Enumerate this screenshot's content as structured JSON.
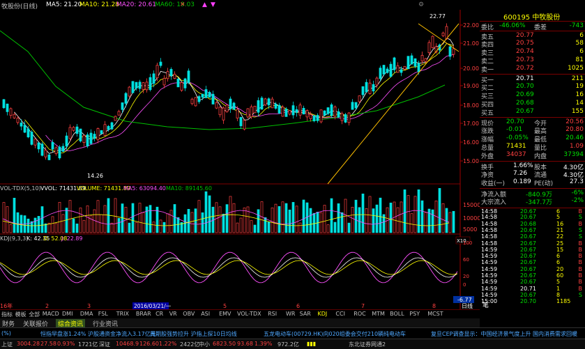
{
  "colors": {
    "up": "#ff4040",
    "down": "#00e0e0",
    "ma5": "#ffffff",
    "ma10": "#ffff00",
    "ma20": "#ff50ff",
    "ma60": "#00c000",
    "axis": "#a00000",
    "price_label": "#ff4040"
  },
  "header": {
    "title": "牧股份(日线)",
    "ma5": "MA5: 21.20",
    "ma10": "MA10: 21.28",
    "ma20": "MA20: 20.61",
    "ma60": "MA60: 19.03",
    "icons": [
      "close-icon",
      "arrow-up-icon",
      "arrow-down-icon",
      "settings-icon"
    ]
  },
  "price_axis": [
    "22.00",
    "21.00",
    "20.00",
    "19.00",
    "18.00",
    "17.00",
    "16.00",
    "15.00"
  ],
  "price_marks": {
    "high": "22.77",
    "low": "14.26"
  },
  "volume_header": {
    "name": "VOL-TDX(5,10)",
    "vvol": "VVOL: 71431.89",
    "volume": "VOLUME: 71431.89",
    "ma5": "MA5: 63094.40",
    "ma10": "MA10: 89145.60"
  },
  "volume_axis": [
    "15000",
    "10000",
    "5000"
  ],
  "volume_unit": "X10",
  "kdj_header": {
    "name": "KDJ(9,3,3)",
    "k": "K: 42.35",
    "d": "D: 52.08",
    "j": "J: 22.89"
  },
  "kdj_axis": [
    "100",
    "80",
    "60",
    "40",
    "20",
    "0"
  ],
  "kdj_last": "-6.77",
  "date_labels": {
    "start": "16年",
    "m2": "2",
    "m3": "3",
    "cursor": "2016/03/21/一",
    "m4": "4",
    "m5": "5",
    "m6": "6",
    "m7": "7",
    "m8": "8",
    "period": "日线"
  },
  "indicator_tabs": [
    "指标",
    "模板",
    "全部",
    "MACD",
    "DMI",
    "DMA",
    "FSL",
    "TRIX",
    "BRAR",
    "CR",
    "VR",
    "OBV",
    "ASI",
    "EMV",
    "VOL-TDX",
    "RSI",
    "WR",
    "SAR",
    "KDJ",
    "CCI",
    "ROC",
    "MTM",
    "BOLL",
    "PSY",
    "MCST"
  ],
  "active_indicator": "KDJ",
  "bottom_tabs": [
    "财务",
    "关联报价",
    "综合资讯",
    "行业资讯"
  ],
  "active_bottom_tab": "综合资讯",
  "quote": {
    "code_name": "600195 中牧股份",
    "ratio_label": "委比",
    "ratio": "-46.06%",
    "diff_label": "委差",
    "diff": "-743",
    "sells": [
      {
        "label": "卖五",
        "price": "20.77",
        "vol": "6"
      },
      {
        "label": "卖四",
        "price": "20.75",
        "vol": "58"
      },
      {
        "label": "卖三",
        "price": "20.74",
        "vol": "6"
      },
      {
        "label": "卖二",
        "price": "20.73",
        "vol": "81"
      },
      {
        "label": "卖一",
        "price": "20.72",
        "vol": "1025"
      }
    ],
    "buys": [
      {
        "label": "买一",
        "price": "20.71",
        "vol": "211"
      },
      {
        "label": "买二",
        "price": "20.70",
        "vol": "19"
      },
      {
        "label": "买三",
        "price": "20.69",
        "vol": "16"
      },
      {
        "label": "买四",
        "price": "20.68",
        "vol": "14"
      },
      {
        "label": "买五",
        "price": "20.67",
        "vol": "155"
      }
    ],
    "stats": [
      {
        "l1": "现价",
        "v1": "20.70",
        "l2": "今开",
        "v2": "20.56",
        "c1": "grn",
        "c2": "red"
      },
      {
        "l1": "涨跌",
        "v1": "-0.01",
        "l2": "最高",
        "v2": "20.80",
        "c1": "grn",
        "c2": "red"
      },
      {
        "l1": "涨幅",
        "v1": "-0.05%",
        "l2": "最低",
        "v2": "20.46",
        "c1": "grn",
        "c2": "grn"
      },
      {
        "l1": "总量",
        "v1": "71431",
        "l2": "量比",
        "v2": "1.09",
        "c1": "yel",
        "c2": "red"
      },
      {
        "l1": "外盘",
        "v1": "34037",
        "l2": "内盘",
        "v2": "37394",
        "c1": "red",
        "c2": "grn"
      }
    ],
    "stats2": [
      {
        "l1": "换手",
        "v1": "1.66%",
        "l2": "股本",
        "v2": "4.30亿"
      },
      {
        "l1": "净资",
        "v1": "7.26",
        "l2": "流通",
        "v2": "4.30亿"
      },
      {
        "l1": "收益(一)",
        "v1": "0.189",
        "l2": "PE(动)",
        "v2": "27.3"
      }
    ],
    "flow": [
      {
        "label": "净流入额",
        "value": "-840.9万",
        "pct": "-6%"
      },
      {
        "label": "大宗流入",
        "value": "-347.7万",
        "pct": "-2%"
      }
    ],
    "ticks": [
      {
        "t": "14:58",
        "p": "20.67",
        "v": "6",
        "d": "B"
      },
      {
        "t": "14:58",
        "p": "20.67",
        "v": "5",
        "d": "S"
      },
      {
        "t": "14:58",
        "p": "20.68",
        "v": "16",
        "d": "B"
      },
      {
        "t": "14:58",
        "p": "20.67",
        "v": "21",
        "d": "S"
      },
      {
        "t": "14:58",
        "p": "20.67",
        "v": "22",
        "d": "S"
      },
      {
        "t": "14:58",
        "p": "20.67",
        "v": "25",
        "d": "B"
      },
      {
        "t": "14:59",
        "p": "20.67",
        "v": "15",
        "d": "B"
      },
      {
        "t": "14:59",
        "p": "20.67",
        "v": "6",
        "d": "B"
      },
      {
        "t": "14:59",
        "p": "20.67",
        "v": "6",
        "d": "B"
      },
      {
        "t": "14:59",
        "p": "20.67",
        "v": "20",
        "d": "B"
      },
      {
        "t": "14:59",
        "p": "20.67",
        "v": "60",
        "d": "B"
      },
      {
        "t": "14:59",
        "p": "20.67",
        "v": "5",
        "d": "B"
      },
      {
        "t": "14:59",
        "p": "20.71",
        "v": "1",
        "d": "B"
      },
      {
        "t": "14:59",
        "p": "20.67",
        "v": "8",
        "d": "S"
      },
      {
        "t": "15:00",
        "p": "20.70",
        "v": "1185",
        "d": ""
      }
    ],
    "tick_tab": "笔"
  },
  "ticker": [
    {
      "text": "(%)"
    },
    {
      "text": "恒指早盘涨1.24% 沪股通资金净流入3.17亿元"
    },
    {
      "text": "周期股强势拉升 沪指上探10日均线"
    },
    {
      "text": "五龙电动车(00729.HK)向020组委会交付210辆纯电动车"
    },
    {
      "text": "复旦CEP调查显示：中国经济景气度上升 国内消费需求回暖"
    }
  ],
  "status": {
    "sh_label": "上证",
    "sh_val": "3004.28",
    "sh_chg": "27.58",
    "sh_pct": "0.93%",
    "sh_amt": "1721亿",
    "sz_label": "深证",
    "sz_val": "10468.9",
    "sz_chg": "126.60",
    "sz_pct": "1.22%",
    "sz_amt": "2422亿",
    "zx_label": "中小",
    "zx_val": "6823.50",
    "zx_chg": "93.68",
    "zx_pct": "1.39%",
    "zx_amt": "972.2亿",
    "broker": "东北证券网通2"
  }
}
